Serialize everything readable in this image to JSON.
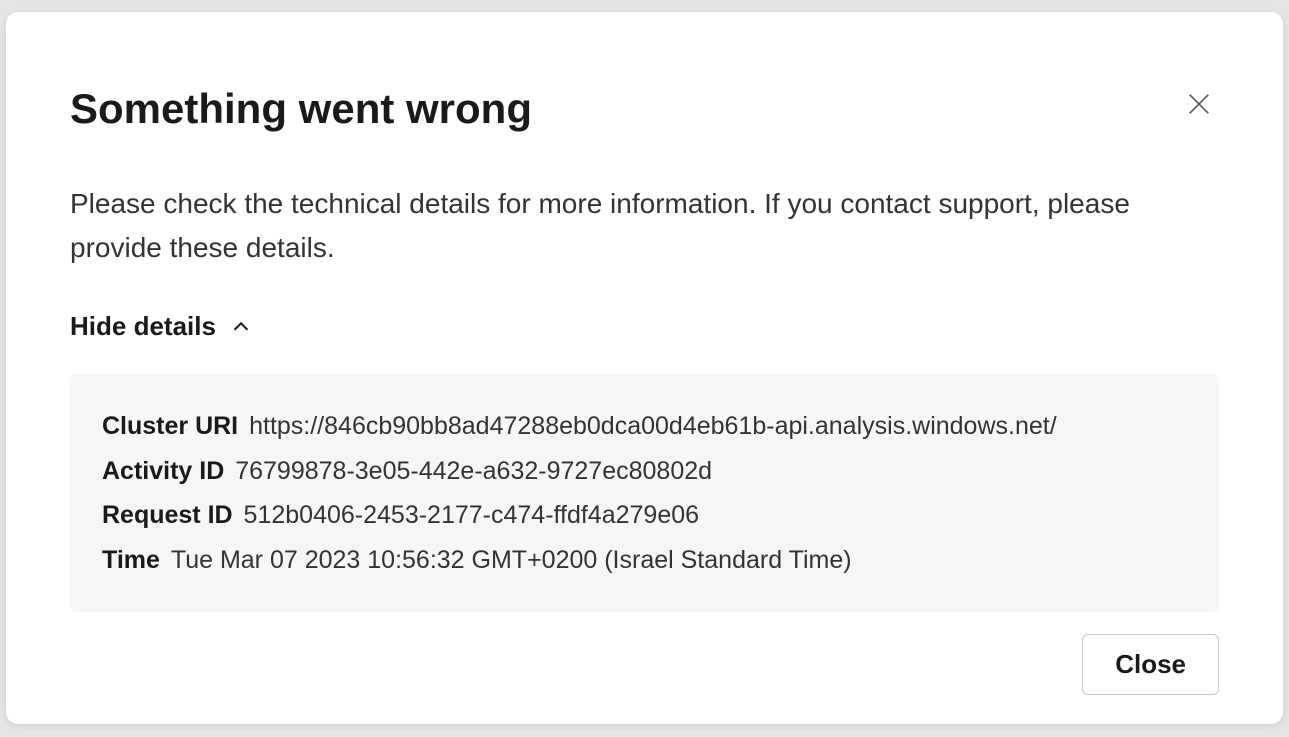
{
  "dialog": {
    "title": "Something went wrong",
    "message": "Please check the technical details for more information. If you contact support, please provide these details.",
    "toggle_label": "Hide details",
    "close_button_label": "Close",
    "details": {
      "cluster_uri": {
        "label": "Cluster URI",
        "value": "https://846cb90bb8ad47288eb0dca00d4eb61b-api.analysis.windows.net/"
      },
      "activity_id": {
        "label": "Activity ID",
        "value": "76799878-3e05-442e-a632-9727ec80802d"
      },
      "request_id": {
        "label": "Request ID",
        "value": "512b0406-2453-2177-c474-ffdf4a279e06"
      },
      "time": {
        "label": "Time",
        "value": "Tue Mar 07 2023 10:56:32 GMT+0200 (Israel Standard Time)"
      }
    }
  }
}
